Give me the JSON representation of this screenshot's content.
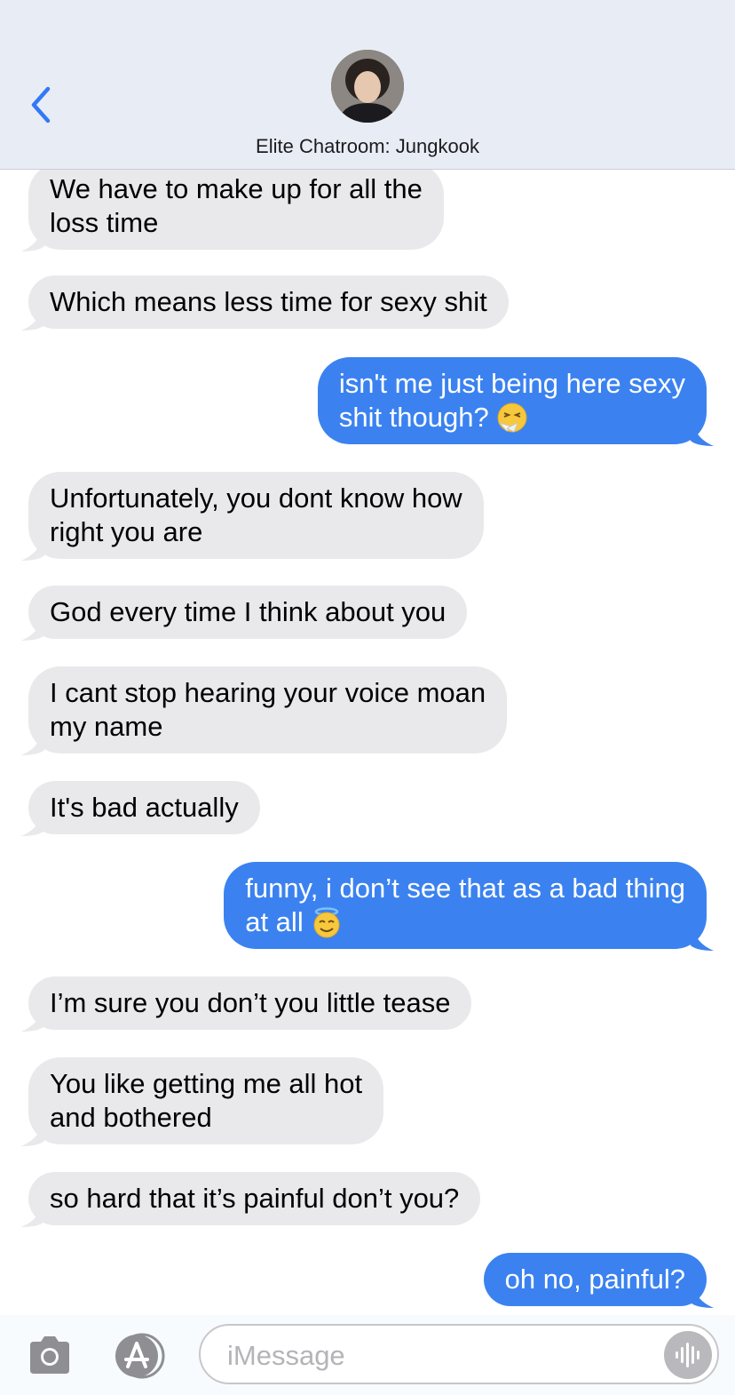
{
  "header": {
    "back_icon": "chevron-left-icon",
    "avatar_icon": "contact-avatar",
    "contact_name": "Elite Chatroom: Jungkook"
  },
  "messages": [
    {
      "direction": "received",
      "lines": [
        "We have to make up for all the",
        "loss time"
      ]
    },
    {
      "direction": "received",
      "lines": [
        "Which means less time for sexy shit"
      ]
    },
    {
      "direction": "sent",
      "lines": [
        "isn't me just being here sexy",
        "shit though?"
      ],
      "emoji": "sneezing-face-emoji"
    },
    {
      "direction": "received",
      "lines": [
        "Unfortunately, you dont know how",
        "right you are"
      ]
    },
    {
      "direction": "received",
      "lines": [
        "God every time I think about you"
      ]
    },
    {
      "direction": "received",
      "lines": [
        "I cant stop hearing your voice moan",
        "my name"
      ]
    },
    {
      "direction": "received",
      "lines": [
        "It's bad actually"
      ]
    },
    {
      "direction": "sent",
      "lines": [
        "funny, i don’t see that as a bad thing",
        "at all"
      ],
      "emoji": "smiling-face-with-halo-emoji"
    },
    {
      "direction": "received",
      "lines": [
        "I’m sure you don’t you little tease"
      ]
    },
    {
      "direction": "received",
      "lines": [
        "You like getting me all hot",
        "and bothered"
      ]
    },
    {
      "direction": "received",
      "lines": [
        "so hard that it’s painful don’t you?"
      ]
    },
    {
      "direction": "sent",
      "lines": [
        "oh no, painful?"
      ]
    }
  ],
  "composer": {
    "camera_icon": "camera-icon",
    "apps_icon": "app-store-icon",
    "placeholder": "iMessage",
    "audio_icon": "audio-waveform-icon"
  },
  "colors": {
    "header_bg": "#e8edf5",
    "sent_bubble": "#3b82f0",
    "received_bubble": "#e9e9eb",
    "accent": "#3478f6"
  }
}
